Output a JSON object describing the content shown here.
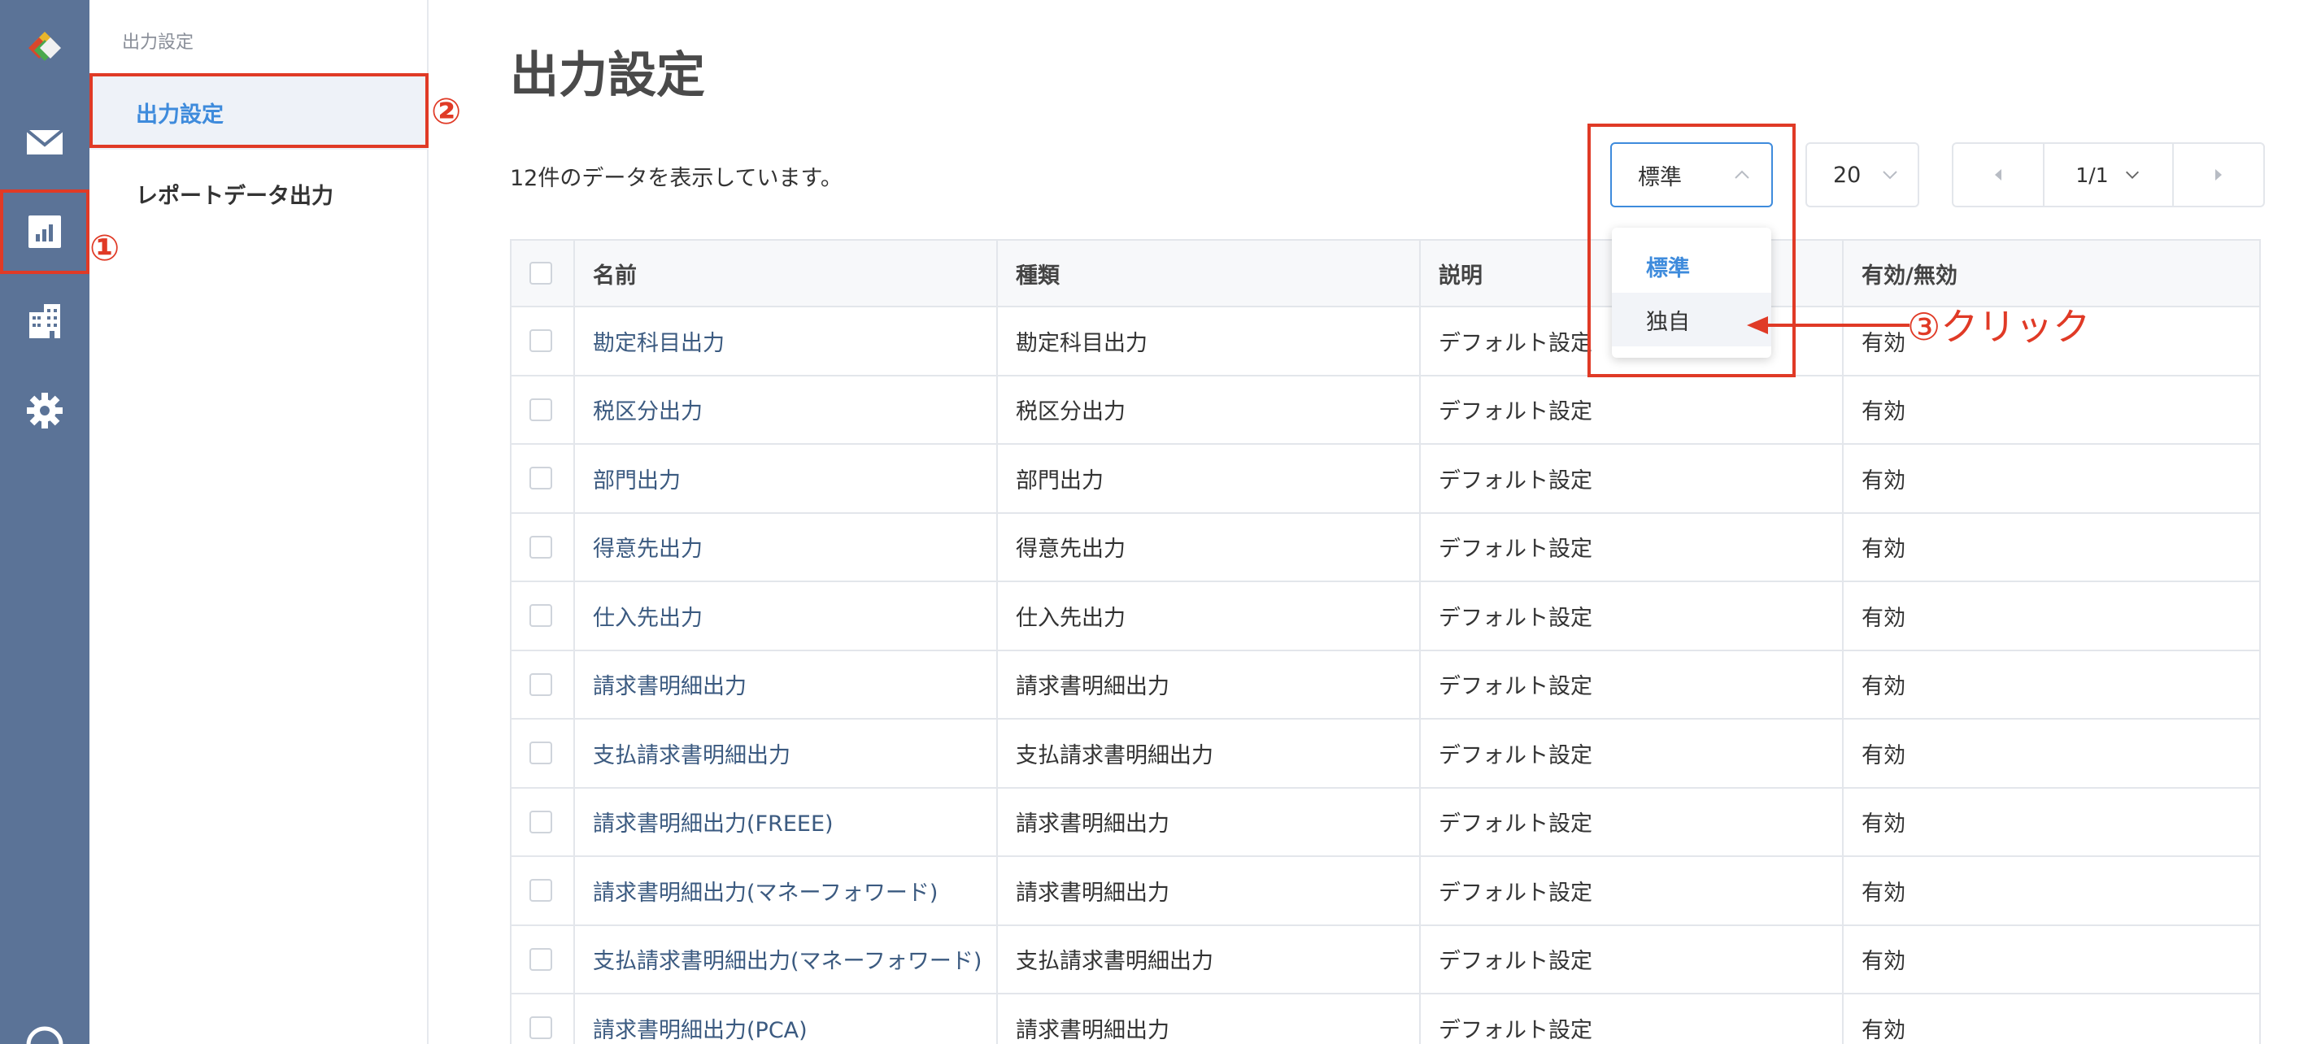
{
  "rail": {
    "icons": [
      "logo-icon",
      "mail-icon",
      "report-icon",
      "building-icon",
      "gear-icon",
      "help-icon"
    ]
  },
  "subnav": {
    "title": "出力設定",
    "items": [
      {
        "label": "出力設定",
        "active": true
      },
      {
        "label": "レポートデータ出力",
        "active": false
      }
    ]
  },
  "main": {
    "title": "出力設定",
    "count_text": "12件のデータを表示しています。",
    "type_select": {
      "value": "標準",
      "options": [
        "標準",
        "独自"
      ]
    },
    "page_size": "20",
    "pager": {
      "page": "1/1"
    }
  },
  "table": {
    "headers": [
      "名前",
      "種類",
      "説明",
      "有効/無効"
    ],
    "rows": [
      {
        "name": "勘定科目出力",
        "type": "勘定科目出力",
        "desc": "デフォルト設定",
        "status": "有効"
      },
      {
        "name": "税区分出力",
        "type": "税区分出力",
        "desc": "デフォルト設定",
        "status": "有効"
      },
      {
        "name": "部門出力",
        "type": "部門出力",
        "desc": "デフォルト設定",
        "status": "有効"
      },
      {
        "name": "得意先出力",
        "type": "得意先出力",
        "desc": "デフォルト設定",
        "status": "有効"
      },
      {
        "name": "仕入先出力",
        "type": "仕入先出力",
        "desc": "デフォルト設定",
        "status": "有効"
      },
      {
        "name": "請求書明細出力",
        "type": "請求書明細出力",
        "desc": "デフォルト設定",
        "status": "有効"
      },
      {
        "name": "支払請求書明細出力",
        "type": "支払請求書明細出力",
        "desc": "デフォルト設定",
        "status": "有効"
      },
      {
        "name": "請求書明細出力(FREEE)",
        "type": "請求書明細出力",
        "desc": "デフォルト設定",
        "status": "有効"
      },
      {
        "name": "請求書明細出力(マネーフォワード)",
        "type": "請求書明細出力",
        "desc": "デフォルト設定",
        "status": "有効"
      },
      {
        "name": "支払請求書明細出力(マネーフォワード)",
        "type": "支払請求書明細出力",
        "desc": "デフォルト設定",
        "status": "有効"
      },
      {
        "name": "請求書明細出力(PCA)",
        "type": "請求書明細出力",
        "desc": "デフォルト設定",
        "status": "有効"
      }
    ]
  },
  "annotations": {
    "step1": "①",
    "step2": "②",
    "step3": "③クリック"
  },
  "colors": {
    "rail": "#5b7397",
    "accent": "#3e8bdc",
    "annotation": "#e03a26"
  }
}
